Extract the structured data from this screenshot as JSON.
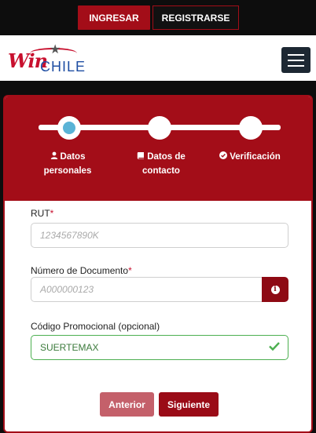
{
  "topbar": {
    "login_label": "INGRESAR",
    "register_label": "REGISTRARSE"
  },
  "header": {
    "logo_win": "Win",
    "logo_chile": "CHILE"
  },
  "steps": [
    {
      "label": "Datos personales",
      "icon": "user-icon"
    },
    {
      "label": "Datos de contacto",
      "icon": "book-icon"
    },
    {
      "label": "Verificación",
      "icon": "check-circle-icon"
    }
  ],
  "form": {
    "rut": {
      "label": "RUT",
      "required_mark": "*",
      "placeholder": "1234567890K",
      "value": ""
    },
    "documento": {
      "label": "Número de Documento",
      "required_mark": "*",
      "placeholder": "A000000123",
      "value": ""
    },
    "promo": {
      "label": "Código Promocional (opcional)",
      "value": "SUERTEMAX"
    }
  },
  "buttons": {
    "previous": "Anterior",
    "next": "Siguiente"
  },
  "colors": {
    "brand_red": "#a30d18",
    "progress_active": "#5ab3d6",
    "valid_green": "#4caf50",
    "nav_dark": "#1d2833"
  }
}
